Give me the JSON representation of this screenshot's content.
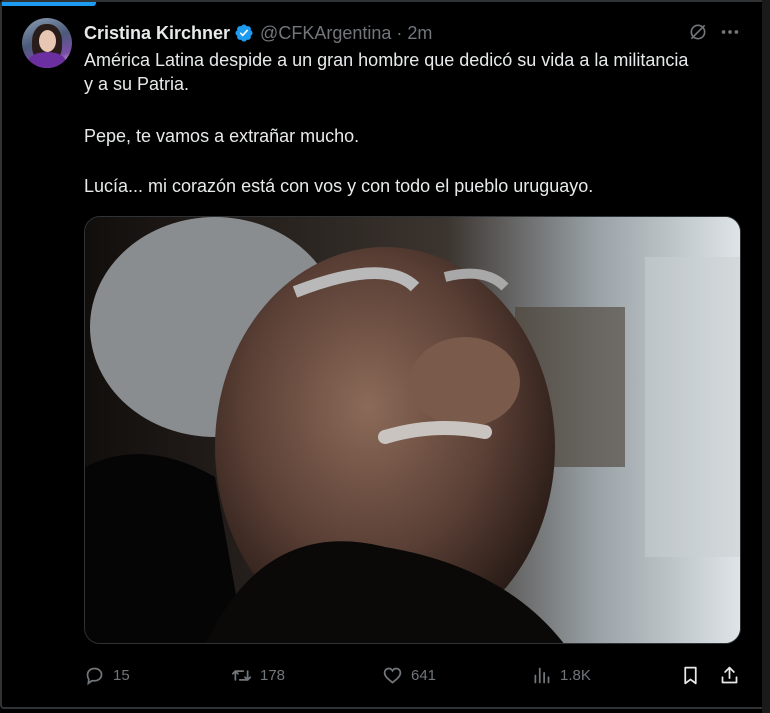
{
  "post": {
    "author_name": "Cristina Kirchner",
    "handle": "@CFKArgentina",
    "separator": "·",
    "time": "2m",
    "lines": [
      "América Latina despide a un gran hombre que dedicó su vida a la militancia",
      "y a su Patria.",
      "Pepe, te vamos a extrañar mucho.",
      "Lucía... mi corazón está con vos y con todo el pueblo uruguayo."
    ]
  },
  "icons": {
    "verified": "verified-badge-icon",
    "grok": "grok-icon",
    "more": "more-icon",
    "reply": "reply-icon",
    "retweet": "retweet-icon",
    "like": "like-icon",
    "views": "views-icon",
    "bookmark": "bookmark-icon",
    "share": "share-icon"
  },
  "actions": {
    "replies": "15",
    "retweets": "178",
    "likes": "641",
    "views": "1.8K"
  },
  "colors": {
    "background": "#000000",
    "text": "#e7e9ea",
    "muted": "#71767b",
    "accent": "#1d9bf0"
  }
}
